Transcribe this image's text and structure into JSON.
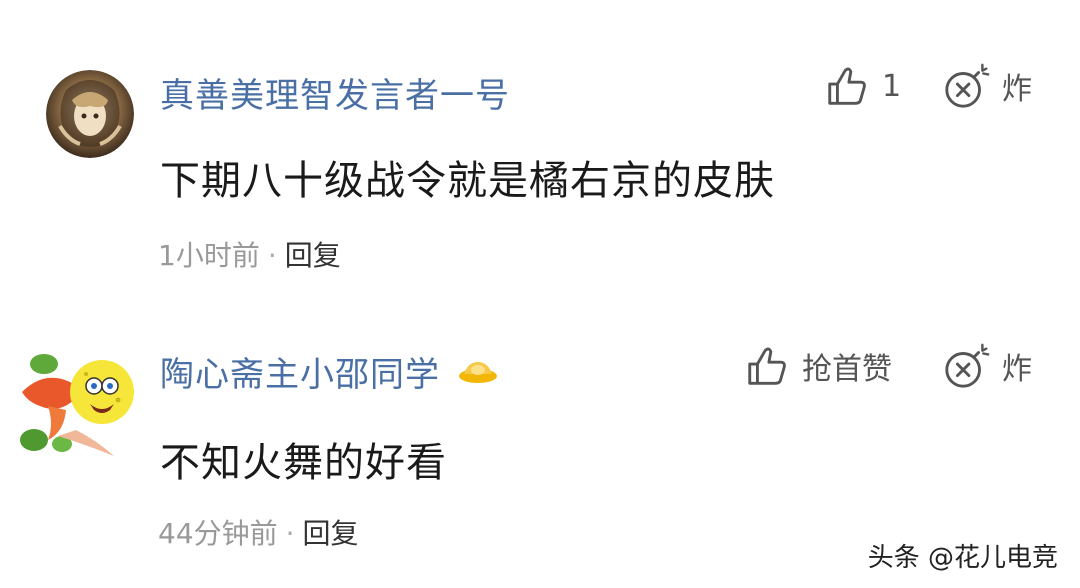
{
  "comments": [
    {
      "username": "真善美理智发言者一号",
      "content": "下期八十级战令就是橘右京的皮肤",
      "time": "1小时前",
      "separator": "·",
      "reply_label": "回复",
      "like_label": "1",
      "bomb_label": "炸",
      "avatar_icon": "anime-avatar",
      "has_vip_badge": false
    },
    {
      "username": "陶心斋主小邵同学",
      "content": "不知火舞的好看",
      "time": "44分钟前",
      "separator": "·",
      "reply_label": "回复",
      "like_label": "抢首赞",
      "bomb_label": "炸",
      "avatar_icon": "spongebob-koi-avatar",
      "has_vip_badge": true,
      "vip_badge_icon": "gold-ingot-icon"
    }
  ],
  "watermark": "头条 @花儿电竞",
  "colors": {
    "username": "#4a6fa5",
    "meta": "#999999",
    "icon": "#555555",
    "badge_gold": "#f2b705"
  }
}
